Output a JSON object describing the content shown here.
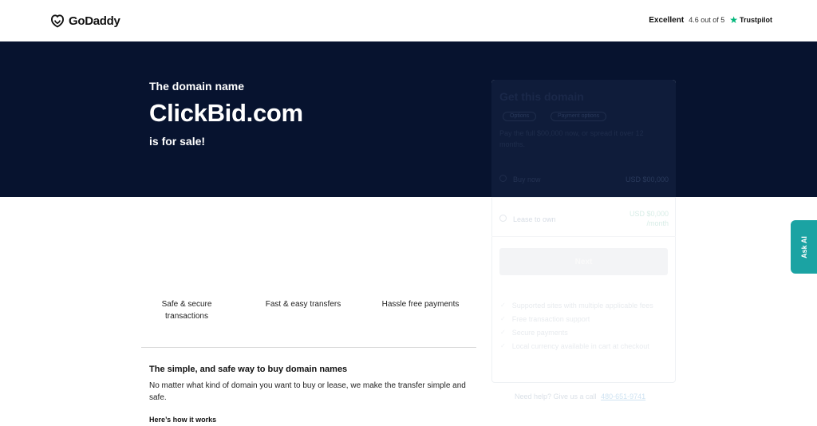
{
  "header": {
    "brand": "GoDaddy",
    "trustpilot": {
      "label": "Excellent",
      "rating_text": "4.6 out of 5",
      "brand": "Trustpilot",
      "star_color": "#00b67a"
    }
  },
  "hero": {
    "line1": "The domain name",
    "domain": "ClickBid.com",
    "line3": "is for sale!",
    "background": "#07132f"
  },
  "purchase_card": {
    "title": "Get this domain",
    "tabs": [
      "Options",
      "Payment options"
    ],
    "description": "Pay the full $00,000 now, or spread it over 12 months.",
    "options": [
      {
        "label": "Buy now",
        "price": "USD $00,000"
      },
      {
        "label": "Lease to own",
        "price": "USD $0,000",
        "price_note": "/month"
      }
    ],
    "next_label": "Next",
    "benefits": [
      "Supported sites with multiple applicable fees",
      "Free transaction support",
      "Secure payments",
      "Local currency available in cart at checkout"
    ],
    "help_text": "Need help? Give us a call",
    "help_phone": "480-651-9741"
  },
  "ask_ai": {
    "label": "Ask AI",
    "color": "#1ba3a3"
  },
  "features": [
    {
      "label": "Safe & secure transactions"
    },
    {
      "label": "Fast & easy transfers"
    },
    {
      "label": "Hassle free payments"
    }
  ],
  "info": {
    "title": "The simple, and safe way to buy domain names",
    "body": "No matter what kind of domain you want to buy or lease, we make the transfer simple and safe.",
    "how_title": "Here’s how it works"
  }
}
